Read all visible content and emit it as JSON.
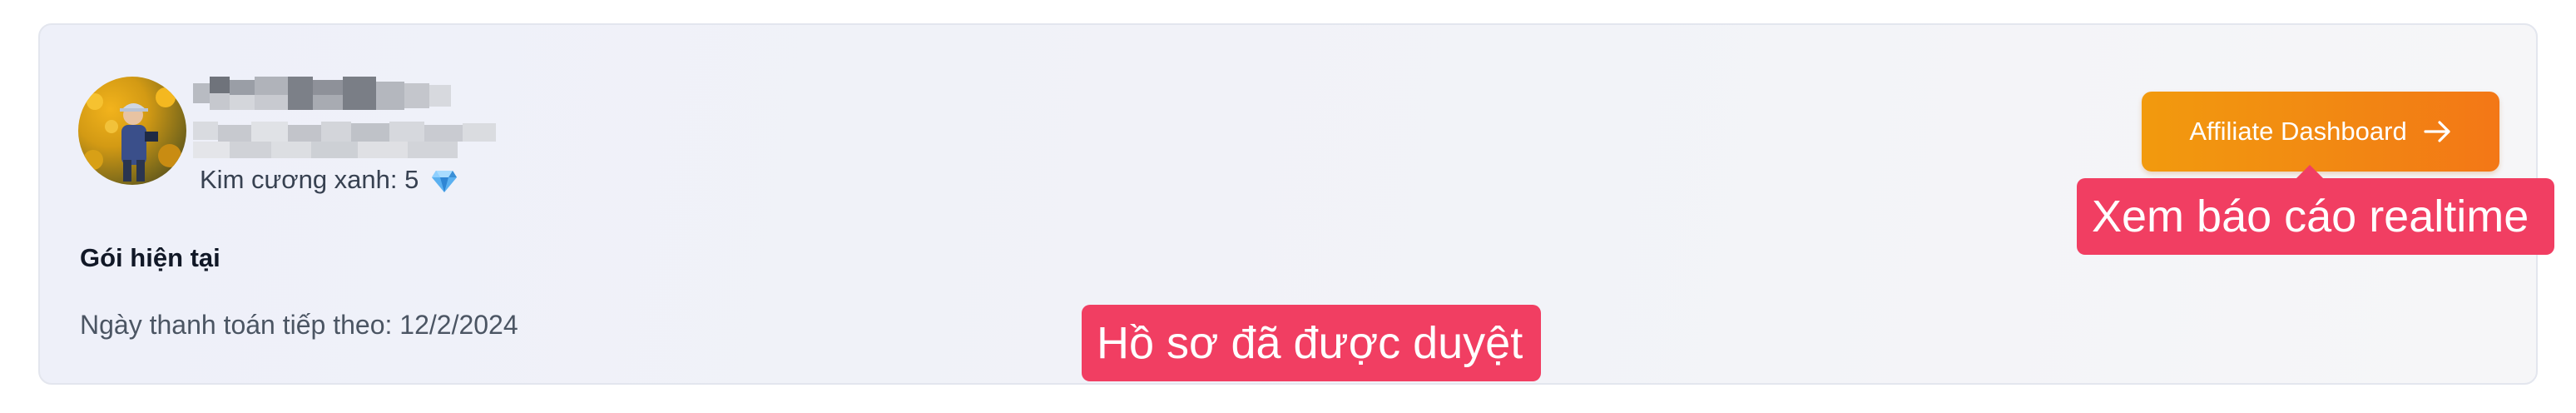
{
  "profile": {
    "diamond_text": "Kim cương xanh: 5",
    "diamond_icon": "gem-icon"
  },
  "plan": {
    "title": "Gói hiện tại",
    "next_payment": "Ngày thanh toán tiếp theo: 12/2/2024"
  },
  "actions": {
    "affiliate_label": "Affiliate Dashboard",
    "affiliate_icon": "arrow-right-icon"
  },
  "tooltips": {
    "realtime": "Xem báo cáo realtime",
    "approved": "Hồ sơ đã được duyệt"
  },
  "colors": {
    "accent_orange": "#f28a12",
    "tooltip_pink": "#f13e62",
    "card_background": "#eef0f9"
  }
}
